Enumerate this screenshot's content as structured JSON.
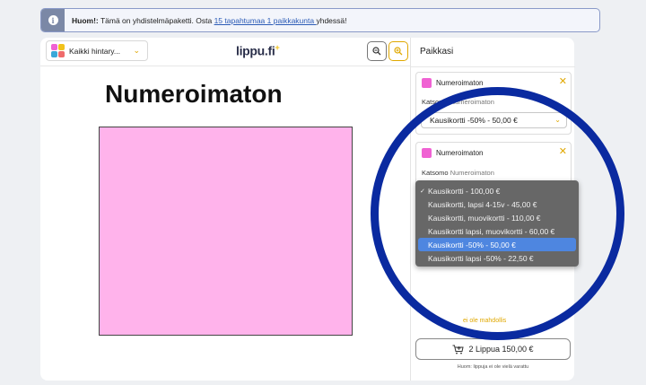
{
  "notice": {
    "bold": "Huom!:",
    "text_before": " Tämä on yhdistelmäpaketti. Osta ",
    "link": "15 tapahtumaa 1 paikkakunta ",
    "text_after": "yhdessä!",
    "icon": "info-icon"
  },
  "toolbar": {
    "filter_label": "Kaikki hintary...",
    "logo": "lippu.fi",
    "logo_mark": "+",
    "zoom_out_icon": "zoom-out-icon",
    "zoom_in_icon": "zoom-in-icon"
  },
  "map": {
    "section_title": "Numeroimaton",
    "area_color": "#ffb3eb"
  },
  "panel": {
    "heading": "Paikkasi",
    "seats": [
      {
        "name": "Numeroimaton",
        "area_label": "Katsomo",
        "area_value": "Numeroimaton",
        "selected": "Kausikortti -50% - 50,00 €"
      },
      {
        "name": "Numeroimaton",
        "area_label": "Katsomo",
        "area_value": "Numeroimaton"
      }
    ],
    "warning_fragment": "ei ole mahdollis",
    "cart_button": "2 Lippua 150,00 €",
    "footnote": "Huom: lippuja ei ole vielä varattu"
  },
  "dropdown": {
    "options": [
      "Kausikortti - 100,00 €",
      "Kausikortti, lapsi 4-15v - 45,00 €",
      "Kausikortti, muovikortti - 110,00 €",
      "Kausikortti lapsi, muovikortti - 60,00 €",
      "Kausikortti -50% - 50,00 €",
      "Kausikortti lapsi -50% - 22,50 €"
    ],
    "checked_index": 0,
    "highlighted_index": 4
  },
  "colors": {
    "accent": "#e0a800",
    "seat_swatch": "#f062d3",
    "ring": "#0a2aa0",
    "highlight": "#4e86e0"
  }
}
